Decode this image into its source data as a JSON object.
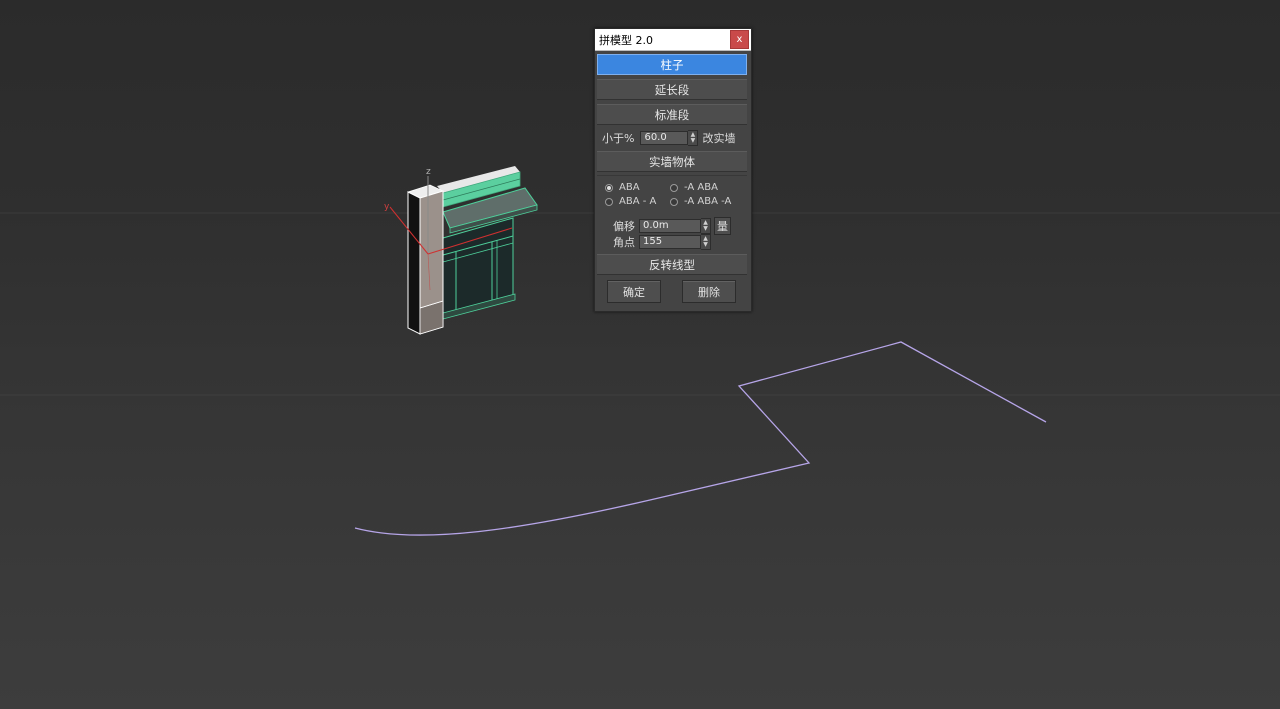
{
  "dialog": {
    "title": "拼模型 2.0",
    "close_label": "x",
    "sections": {
      "pillar": "柱子",
      "extension": "延长段",
      "standard": "标准段",
      "solid_wall_object": "实墙物体",
      "reverse_line": "反转线型"
    },
    "threshold": {
      "prefix": "小于%",
      "value": "60.0",
      "suffix": "改实墙"
    },
    "pattern_options": {
      "aba": "ABA",
      "neg_a_aba": "-A ABA",
      "aba_neg_a": "ABA - A",
      "neg_a_aba_neg_a": "-A ABA -A",
      "selected": "ABA"
    },
    "offset": {
      "label": "偏移",
      "value": "0.0m",
      "pick_label": "量"
    },
    "corner": {
      "label": "角点",
      "value": "155"
    },
    "buttons": {
      "ok": "确定",
      "delete": "删除"
    }
  },
  "viewport": {
    "axis_labels": {
      "z": "z",
      "y": "y"
    },
    "colors": {
      "spline": "#b6a5e8",
      "mesh_green": "#4ecf9a",
      "pillar_face": "#cfcfcf",
      "axis_red": "#d03030"
    }
  }
}
